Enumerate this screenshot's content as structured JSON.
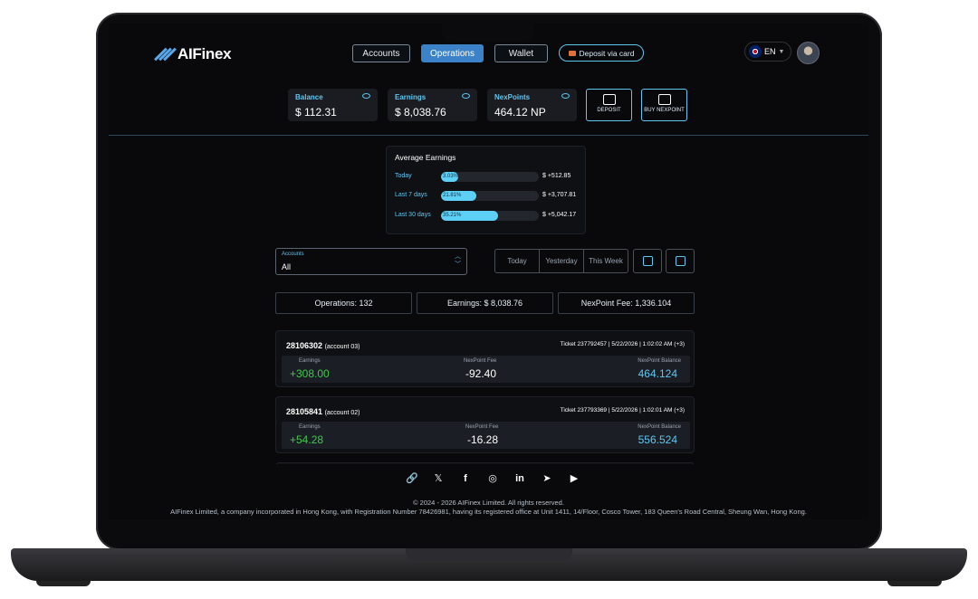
{
  "header": {
    "brand": "AIFinex",
    "nav": [
      {
        "label": "Accounts"
      },
      {
        "label": "Operations"
      },
      {
        "label": "Wallet"
      }
    ],
    "deposit_card_label": "Deposit via card",
    "lang": "EN"
  },
  "stats": [
    {
      "label": "Balance",
      "value": "$ 112.31"
    },
    {
      "label": "Earnings",
      "value": "$ 8,038.76"
    },
    {
      "label": "NexPoints",
      "value": "464.12 NP"
    }
  ],
  "actions": {
    "deposit": "DEPOSIT",
    "buy": "BUY NEXPOINT"
  },
  "average_earnings": {
    "title": "Average Earnings",
    "rows": [
      {
        "label": "Today",
        "percent_text": "3.03%",
        "percent": 3.03,
        "amount": "$ +512.85"
      },
      {
        "label": "Last 7 days",
        "percent_text": "21.81%",
        "percent": 21.81,
        "amount": "$ +3,707.81"
      },
      {
        "label": "Last 30 days",
        "percent_text": "35.21%",
        "percent": 35.21,
        "amount": "$ +5,042.17"
      }
    ]
  },
  "filters": {
    "accounts_label": "Accounts",
    "accounts_value": "All",
    "periods": [
      "Today",
      "Yesterday",
      "This Week"
    ]
  },
  "summary": {
    "operations": "Operations: 132",
    "earnings": "Earnings: $ 8,038.76",
    "fee": "NexPoint Fee: 1,336.104"
  },
  "operations": [
    {
      "id": "28106302",
      "account": "(account 03)",
      "meta": "Ticket 237792457    |    5/22/2026    |    1:02:02 AM (+3)",
      "earnings_label": "Earnings",
      "earnings": "+308.00",
      "fee_label": "NexPoint Fee",
      "fee": "-92.40",
      "balance_label": "NexPoint Balance",
      "balance": "464.124"
    },
    {
      "id": "28105841",
      "account": "(account 02)",
      "meta": "Ticket 237793369    |    5/22/2026    |    1:02:01 AM (+3)",
      "earnings_label": "Earnings",
      "earnings": "+54.28",
      "fee_label": "NexPoint Fee",
      "fee": "-16.28",
      "balance_label": "NexPoint Balance",
      "balance": "556.524"
    }
  ],
  "footer": {
    "copyright": "© 2024 - 2026 AIFinex Limited. All rights reserved.",
    "legal": "AIFinex Limited, a company incorporated in Hong Kong, with Registration Number 78426981, having its registered office at Unit 1411, 14/Floor, Cosco Tower, 183 Queen's Road Central, Sheung Wan, Hong Kong."
  },
  "colors": {
    "accent": "#5fc7f0",
    "primary": "#3b82c8",
    "positive": "#3fc94b"
  }
}
